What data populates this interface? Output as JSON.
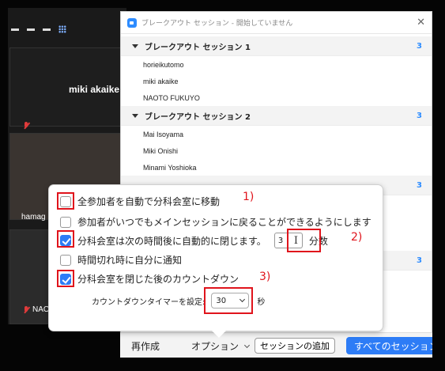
{
  "gallery": {
    "participant_main": "miki akaike",
    "participant_2": "hamag",
    "participant_3": "NAO"
  },
  "breakout": {
    "title": "ブレークアウト セッション - 開始していません",
    "close_symbol": "✕",
    "rooms": [
      {
        "name": "ブレークアウト セッション 1",
        "count": "3",
        "members": [
          "horieikutomo",
          "miki akaike",
          "NAOTO FUKUYO"
        ]
      },
      {
        "name": "ブレークアウト セッション 2",
        "count": "3",
        "members": [
          "Mai Isoyama",
          "Miki Onishi",
          "Minami Yoshioka"
        ]
      }
    ],
    "hidden_counts": [
      "3",
      "3"
    ]
  },
  "options": {
    "auto_move": {
      "label": "全参加者を自動で分科会室に移動",
      "checked": false,
      "annotation": "1)"
    },
    "return_anytime": {
      "label": "参加者がいつでもメインセッションに戻ることができるようにします",
      "checked": false
    },
    "auto_close": {
      "label": "分科会室は次の時間後に自動的に閉じます。",
      "checked": true,
      "value": "3",
      "unit": "分数",
      "annotation": "2)"
    },
    "notify": {
      "label": "時間切れ時に自分に通知",
      "checked": false
    },
    "countdown": {
      "label": "分科会室を閉じた後のカウントダウン",
      "checked": true,
      "annotation": "3)"
    },
    "timer": {
      "label": "カウントダウンタイマーを設定:",
      "value": "30",
      "unit": "秒"
    }
  },
  "bottombar": {
    "recreate": "再作成",
    "options": "オプション",
    "add_session": "セッションの追加",
    "open_all": "すべてのセッション"
  },
  "colors": {
    "accent": "#2d7cf6",
    "annotation": "#e0141c",
    "count": "#2d8cff"
  }
}
